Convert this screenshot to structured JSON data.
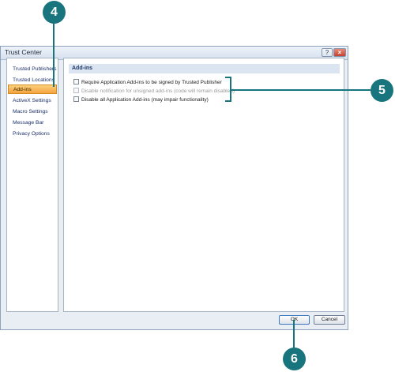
{
  "window": {
    "title": "Trust Center",
    "help_icon": "?",
    "close_icon": "×"
  },
  "sidebar": {
    "items": [
      {
        "label": "Trusted Publishers",
        "active": false
      },
      {
        "label": "Trusted Locations",
        "active": false
      },
      {
        "label": "Add-ins",
        "active": true
      },
      {
        "label": "ActiveX Settings",
        "active": false
      },
      {
        "label": "Macro Settings",
        "active": false
      },
      {
        "label": "Message Bar",
        "active": false
      },
      {
        "label": "Privacy Options",
        "active": false
      }
    ]
  },
  "main": {
    "section_title": "Add-ins",
    "options": [
      {
        "label": "Require Application Add-ins to be signed by Trusted Publisher",
        "checked": false,
        "enabled": true
      },
      {
        "label": "Disable notification for unsigned add-ins (code will remain disabled)",
        "checked": false,
        "enabled": false
      },
      {
        "label": "Disable all Application Add-ins (may impair functionality)",
        "checked": false,
        "enabled": true
      }
    ]
  },
  "buttons": {
    "ok_label": "OK",
    "cancel_label": "Cancel"
  },
  "callouts": {
    "c4": "4",
    "c5": "5",
    "c6": "6"
  },
  "colors": {
    "callout": "#18757d",
    "active_item": "#f4a23e"
  }
}
